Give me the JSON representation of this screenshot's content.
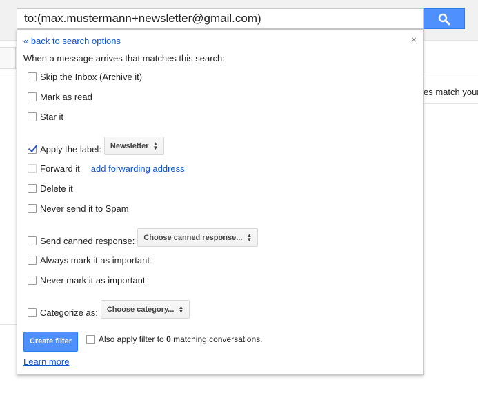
{
  "search": {
    "query": "to:(max.mustermann+newsletter@gmail.com)"
  },
  "background": {
    "partial_text": "es match your"
  },
  "dialog": {
    "back_link": "« back to search options",
    "close": "×",
    "intro": "When a message arrives that matches this search:",
    "options": {
      "skip_inbox": "Skip the Inbox (Archive it)",
      "mark_read": "Mark as read",
      "star": "Star it",
      "apply_label": "Apply the label:",
      "apply_label_value": "Newsletter",
      "forward": "Forward it",
      "forward_link": "add forwarding address",
      "delete": "Delete it",
      "never_spam": "Never send it to Spam",
      "canned": "Send canned response:",
      "canned_value": "Choose canned response...",
      "always_important": "Always mark it as important",
      "never_important": "Never mark it as important",
      "categorize": "Categorize as:",
      "categorize_value": "Choose category..."
    },
    "create_button": "Create filter",
    "also_apply_prefix": "Also apply filter to",
    "also_apply_count": "0",
    "also_apply_suffix": "matching conversations.",
    "learn_more": "Learn more"
  },
  "colors": {
    "accent": "#4d90fe",
    "link": "#1155cc"
  }
}
